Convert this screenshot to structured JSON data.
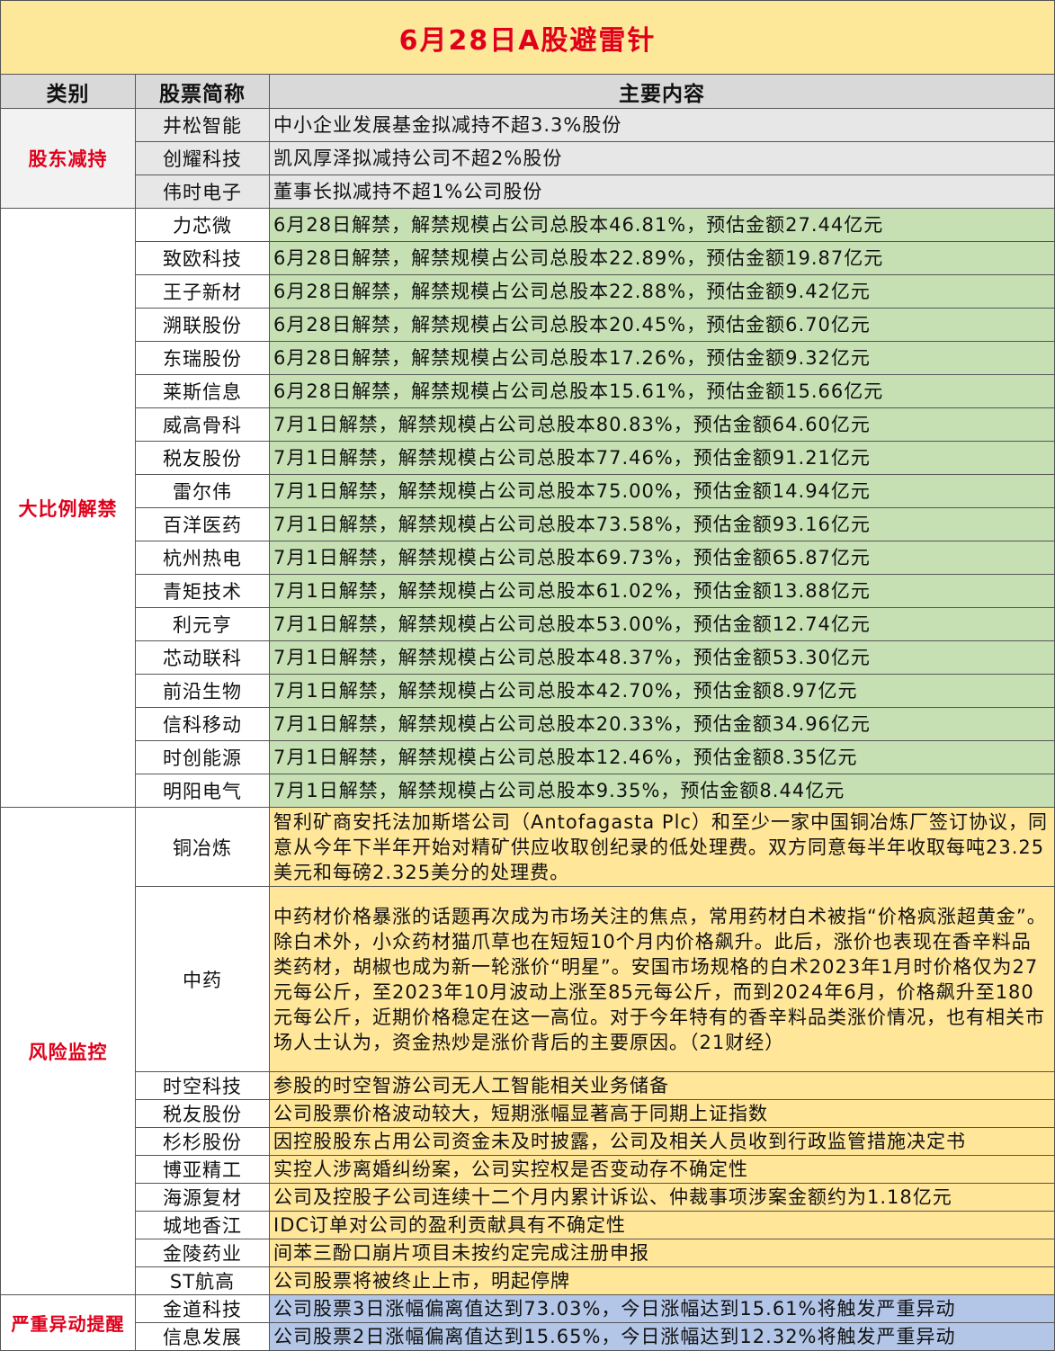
{
  "title": "6月28日A股避雷针",
  "headers": {
    "category": "类别",
    "stock": "股票简称",
    "content": "主要内容"
  },
  "groups": {
    "hold": {
      "label": "股东减持",
      "rows": [
        {
          "name": "井松智能",
          "content": "中小企业发展基金拟减持不超3.3%股份"
        },
        {
          "name": "创耀科技",
          "content": "凯风厚泽拟减持公司不超2%股份"
        },
        {
          "name": "伟时电子",
          "content": "董事长拟减持不超1%公司股份"
        }
      ]
    },
    "lift": {
      "label": "大比例解禁",
      "rows": [
        {
          "name": "力芯微",
          "content": "6月28日解禁，解禁规模占公司总股本46.81%，预估金额27.44亿元"
        },
        {
          "name": "致欧科技",
          "content": "6月28日解禁，解禁规模占公司总股本22.89%，预估金额19.87亿元"
        },
        {
          "name": "王子新材",
          "content": "6月28日解禁，解禁规模占公司总股本22.88%，预估金额9.42亿元"
        },
        {
          "name": "溯联股份",
          "content": "6月28日解禁，解禁规模占公司总股本20.45%，预估金额6.70亿元"
        },
        {
          "name": "东瑞股份",
          "content": "6月28日解禁，解禁规模占公司总股本17.26%，预估金额9.32亿元"
        },
        {
          "name": "莱斯信息",
          "content": "6月28日解禁，解禁规模占公司总股本15.61%，预估金额15.66亿元"
        },
        {
          "name": "威高骨科",
          "content": "7月1日解禁，解禁规模占公司总股本80.83%，预估金额64.60亿元"
        },
        {
          "name": "税友股份",
          "content": "7月1日解禁，解禁规模占公司总股本77.46%，预估金额91.21亿元"
        },
        {
          "name": "雷尔伟",
          "content": "7月1日解禁，解禁规模占公司总股本75.00%，预估金额14.94亿元"
        },
        {
          "name": "百洋医药",
          "content": "7月1日解禁，解禁规模占公司总股本73.58%，预估金额93.16亿元"
        },
        {
          "name": "杭州热电",
          "content": "7月1日解禁，解禁规模占公司总股本69.73%，预估金额65.87亿元"
        },
        {
          "name": "青矩技术",
          "content": "7月1日解禁，解禁规模占公司总股本61.02%，预估金额13.88亿元"
        },
        {
          "name": "利元亨",
          "content": "7月1日解禁，解禁规模占公司总股本53.00%，预估金额12.74亿元"
        },
        {
          "name": "芯动联科",
          "content": "7月1日解禁，解禁规模占公司总股本48.37%，预估金额53.30亿元"
        },
        {
          "name": "前沿生物",
          "content": "7月1日解禁，解禁规模占公司总股本42.70%，预估金额8.97亿元"
        },
        {
          "name": "信科移动",
          "content": "7月1日解禁，解禁规模占公司总股本20.33%，预估金额34.96亿元"
        },
        {
          "name": "时创能源",
          "content": "7月1日解禁，解禁规模占公司总股本12.46%，预估金额8.35亿元"
        },
        {
          "name": "明阳电气",
          "content": "7月1日解禁，解禁规模占公司总股本9.35%，预估金额8.44亿元"
        }
      ]
    },
    "risk": {
      "label": "风险监控",
      "rows": [
        {
          "name": "铜冶炼",
          "content": "智利矿商安托法加斯塔公司（Antofagasta Plc）和至少一家中国铜冶炼厂签订协议，同意从今年下半年开始对精矿供应收取创纪录的低处理费。双方同意每半年收取每吨23.25美元和每磅2.325美分的处理费。"
        },
        {
          "name": "中药",
          "content": "中药材价格暴涨的话题再次成为市场关注的焦点，常用药材白术被指“价格疯涨超黄金”。除白术外，小众药材猫爪草也在短短10个月内价格飙升。此后，涨价也表现在香辛料品类药材，胡椒也成为新一轮涨价“明星”。安国市场规格的白术2023年1月时价格仅为27元每公斤，至2023年10月波动上涨至85元每公斤，而到2024年6月，价格飙升至180元每公斤，近期价格稳定在这一高位。对于今年特有的香辛料品类涨价情况，也有相关市场人士认为，资金热炒是涨价背后的主要原因。（21财经）"
        },
        {
          "name": "时空科技",
          "content": "参股的时空智游公司无人工智能相关业务储备"
        },
        {
          "name": "税友股份",
          "content": "公司股票价格波动较大，短期涨幅显著高于同期上证指数"
        },
        {
          "name": "杉杉股份",
          "content": "因控股股东占用公司资金未及时披露，公司及相关人员收到行政监管措施决定书"
        },
        {
          "name": "博亚精工",
          "content": "实控人涉离婚纠纷案，公司实控权是否变动存不确定性"
        },
        {
          "name": "海源复材",
          "content": "公司及控股子公司连续十二个月内累计诉讼、仲裁事项涉案金额约为1.18亿元"
        },
        {
          "name": "城地香江",
          "content": "IDC订单对公司的盈利贡献具有不确定性"
        },
        {
          "name": "金陵药业",
          "content": "间苯三酚口崩片项目未按约定完成注册申报"
        },
        {
          "name": "ST航高",
          "content": "公司股票将被终止上市，明起停牌"
        }
      ]
    },
    "warn": {
      "label": "严重异动提醒",
      "rows": [
        {
          "name": "金道科技",
          "content": "公司股票3日涨幅偏离值达到73.03%，今日涨幅达到15.61%将触发严重异动"
        },
        {
          "name": "信息发展",
          "content": "公司股票2日涨幅偏离值达到15.65%，今日涨幅达到12.32%将触发严重异动"
        }
      ]
    }
  }
}
